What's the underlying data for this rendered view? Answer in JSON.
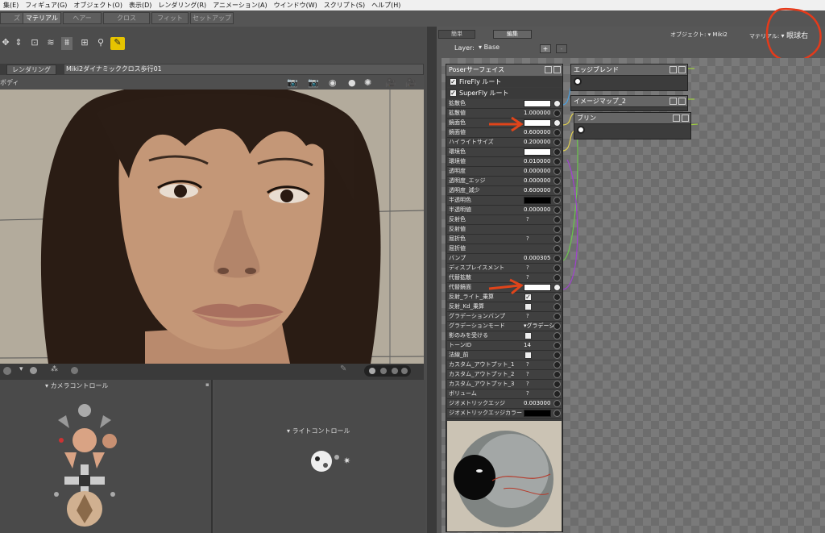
{
  "menubar": {
    "items": [
      "集(E)",
      "フィギュア(G)",
      "オブジェクト(O)",
      "表示(D)",
      "レンダリング(R)",
      "アニメーション(A)",
      "ウインドウ(W)",
      "スクリプト(S)",
      "ヘルプ(H)"
    ]
  },
  "room_tabs": [
    "ズ",
    "マテリアル",
    "ヘアー",
    "クロス",
    "フィット",
    "セットアップ"
  ],
  "left": {
    "render_tab": "レンダリング",
    "scene_title": "Miki2ダイナミッククロス歩行01",
    "camera_label": "ボディ",
    "camera_control_label": "カメラコントロール",
    "light_control_label": "ライトコントロール"
  },
  "right": {
    "tabs": [
      "簡単",
      "編集"
    ],
    "object_label": "オブジェクト:",
    "object_value": "Miki2",
    "material_label": "マテリアル:",
    "material_value": "眼球右",
    "layer_label": "Layer:",
    "layer_value": "Base",
    "add_btn": "+",
    "remove_btn": "-"
  },
  "surface_node": {
    "title": "Poserサーフェイス",
    "root1": "FireFly ルート",
    "root2": "SuperFly ルート",
    "params": [
      {
        "label": "拡散色",
        "type": "swatch",
        "color": "#ffffff",
        "lit": true
      },
      {
        "label": "拡散値",
        "type": "value",
        "value": "1.000000",
        "lit": false
      },
      {
        "label": "鏡面色",
        "type": "swatch",
        "color": "#ffffff",
        "lit": true
      },
      {
        "label": "鏡面値",
        "type": "value",
        "value": "0.600000",
        "lit": false
      },
      {
        "label": "ハイライトサイズ",
        "type": "value",
        "value": "0.200000",
        "lit": false
      },
      {
        "label": "環境色",
        "type": "swatch",
        "color": "#ffffff",
        "lit": false
      },
      {
        "label": "環境値",
        "type": "value",
        "value": "0.010000",
        "lit": false
      },
      {
        "label": "透明度",
        "type": "value",
        "value": "0.000000",
        "lit": false
      },
      {
        "label": "透明度_エッジ",
        "type": "value",
        "value": "0.000000",
        "lit": false
      },
      {
        "label": "透明度_減少",
        "type": "value",
        "value": "0.600000",
        "lit": false
      },
      {
        "label": "半透明色",
        "type": "swatch",
        "color": "#000000",
        "lit": false
      },
      {
        "label": "半透明値",
        "type": "value",
        "value": "0.000000",
        "lit": false
      },
      {
        "label": "反射色",
        "type": "q",
        "value": "?",
        "lit": false
      },
      {
        "label": "反射値",
        "type": "none",
        "value": "",
        "lit": false
      },
      {
        "label": "屈折色",
        "type": "q",
        "value": "?",
        "lit": false
      },
      {
        "label": "屈折値",
        "type": "none",
        "value": "",
        "lit": false
      },
      {
        "label": "バンプ",
        "type": "value",
        "value": "0.000305",
        "lit": false
      },
      {
        "label": "ディスプレイスメント",
        "type": "q",
        "value": "?",
        "lit": false
      },
      {
        "label": "代替拡散",
        "type": "q",
        "value": "?",
        "lit": false
      },
      {
        "label": "代替鏡面",
        "type": "swatch",
        "color": "#ffffff",
        "lit": true
      },
      {
        "label": "反射_ライト_乗算",
        "type": "check",
        "value": "✓",
        "lit": false
      },
      {
        "label": "反射_Kd_乗算",
        "type": "check",
        "value": "",
        "lit": false
      },
      {
        "label": "グラデーションバンプ",
        "type": "q",
        "value": "?",
        "lit": false
      },
      {
        "label": "グラデーションモード",
        "type": "value",
        "value": "▾グラデーショ",
        "lit": false
      },
      {
        "label": "影のみを受ける",
        "type": "check",
        "value": "",
        "lit": false
      },
      {
        "label": "トーンID",
        "type": "value",
        "value": "14",
        "lit": false
      },
      {
        "label": "法線_前",
        "type": "check",
        "value": "",
        "lit": false
      },
      {
        "label": "カスタム_アウトプット_1",
        "type": "q",
        "value": "?",
        "lit": false
      },
      {
        "label": "カスタム_アウトプット_2",
        "type": "q",
        "value": "?",
        "lit": false
      },
      {
        "label": "カスタム_アウトプット_3",
        "type": "q",
        "value": "?",
        "lit": false
      },
      {
        "label": "ボリューム",
        "type": "q",
        "value": "?",
        "lit": false
      },
      {
        "label": "ジオメトリックエッジ",
        "type": "value",
        "value": "0.003000",
        "lit": false
      },
      {
        "label": "ジオメトリックエッジカラー",
        "type": "swatch",
        "color": "#000000",
        "lit": false
      }
    ]
  },
  "nodes": [
    {
      "title": "エッジブレンド"
    },
    {
      "title": "イメージマップ_2"
    },
    {
      "title": "ブリン"
    }
  ]
}
